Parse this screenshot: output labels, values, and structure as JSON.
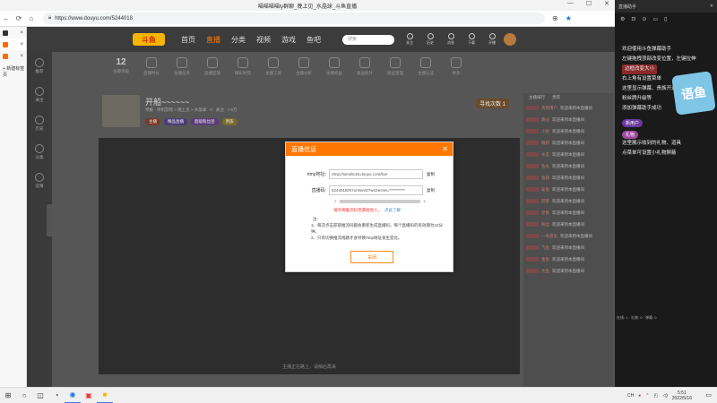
{
  "window": {
    "title": "喵喵喵喵ly群聊_晚上见_水晶球_斗鱼直播",
    "controls": [
      "—",
      "☐",
      "✕"
    ]
  },
  "browser": {
    "url": "https://www.douyu.com/5244018",
    "tabs": [
      {
        "label": "×"
      },
      {
        "label": "×"
      },
      {
        "label": "×"
      }
    ],
    "new_tab_label": "+ 新建标签页"
  },
  "site": {
    "logo_text": "斗鱼",
    "nav": [
      "首页",
      "直播",
      "分类",
      "视频",
      "游戏",
      "鱼吧"
    ],
    "nav_active_index": 1,
    "search_placeholder": "搜索",
    "header_icons": [
      "关注",
      "历史",
      "消息",
      "下载",
      "开播"
    ],
    "sidebar": [
      "推荐",
      "关注",
      "历史",
      "分类",
      "竞猜"
    ],
    "toolbar": {
      "level_num": "12",
      "items": [
        "主播等级",
        "直播时长",
        "主播任务",
        "直播回放",
        "精彩时刻",
        "主播工具",
        "主播分析",
        "主播权益",
        "收益统计",
        "粉丝管理",
        "主播认证",
        "更多"
      ]
    },
    "streamer": {
      "name": "开船~~~~~~",
      "meta": "举报 · 单机游戏 > 晚上见 > 水晶球 · 0 · 关注 · 7.6万",
      "badges": [
        "主播",
        "精品直播",
        "超级粉丝团",
        "贵族"
      ],
      "cta": "寻找次数 1"
    },
    "player_hint": "主播正在路上，请稍后再来",
    "chat": {
      "tabs": [
        "主播排行",
        "贵宾"
      ],
      "rows": [
        {
          "user": "贵宾用户",
          "msg": "欢迎来到本直播间"
        },
        {
          "user": "路过",
          "msg": "欢迎来到本直播间"
        },
        {
          "user": "小鱼",
          "msg": "欢迎来到本直播间"
        },
        {
          "user": "萌新",
          "msg": "欢迎来到本直播间"
        },
        {
          "user": "水友",
          "msg": "欢迎来到本直播间"
        },
        {
          "user": "鱼丸",
          "msg": "欢迎来到本直播间"
        },
        {
          "user": "鱼翅",
          "msg": "欢迎来到本直播间"
        },
        {
          "user": "鲨鱼",
          "msg": "欢迎来到本直播间"
        },
        {
          "user": "游客",
          "msg": "欢迎来到本直播间"
        },
        {
          "user": "老铁",
          "msg": "欢迎来到本直播间"
        },
        {
          "user": "粉丝",
          "msg": "欢迎来到本直播间"
        },
        {
          "user": "一条咸鱼",
          "msg": "欢迎来到本直播间"
        },
        {
          "user": "飞鱼",
          "msg": "欢迎来到本直播间"
        },
        {
          "user": "金鱼",
          "msg": "欢迎来到本直播间"
        },
        {
          "user": "大鱼",
          "msg": "欢迎来到本直播间"
        }
      ]
    }
  },
  "modal": {
    "title": "直播信息",
    "rtmp_label": "rtmp地址:",
    "rtmp_value": "rtmp://sendtc3a.douyu.com/live",
    "copy_label": "复制",
    "key_label": "直播码:",
    "key_value": "5244018rN7unNvvD?wsSecret=**********",
    "warn_text": "请勿将推流码泄漏给他人，",
    "warn_link": "点此了解",
    "notes": [
      "注:",
      "1、每次点击获取推流码都会重新生成直播码，每个直播码的有效期为10分钟。",
      "2、只有切换推流线路才会导致rtmp地址发生变化。"
    ],
    "close_button": "关闭"
  },
  "assistant": {
    "header": "直播助手",
    "lines": [
      "欢迎使用斗鱼弹幕助手",
      "左键拖拽顶部改变位置，左键拉伸",
      "边框改变大小",
      "右上角有设置菜单",
      "这里显示弹幕、贵族开通/续费、",
      "粉丝牌升级等",
      "添加弹幕助手成功"
    ],
    "highlight_line": "边框改变大小",
    "tag1": "新用户",
    "tag2": "礼物",
    "gift_lines": [
      "这里展示收到的礼物、道具",
      "点菜单可设置小礼物屏蔽"
    ],
    "mascot_text": "语鱼",
    "footer": "在线: 1 · 礼物: 0 · 弹幕: 0"
  },
  "taskbar": {
    "time": "5:51",
    "date": "2022/5/16",
    "tray": "CH"
  },
  "colors": {
    "accent": "#ff7700",
    "brand_yellow": "#f7b500",
    "warn_red": "#e33333",
    "link_blue": "#3388dd"
  }
}
